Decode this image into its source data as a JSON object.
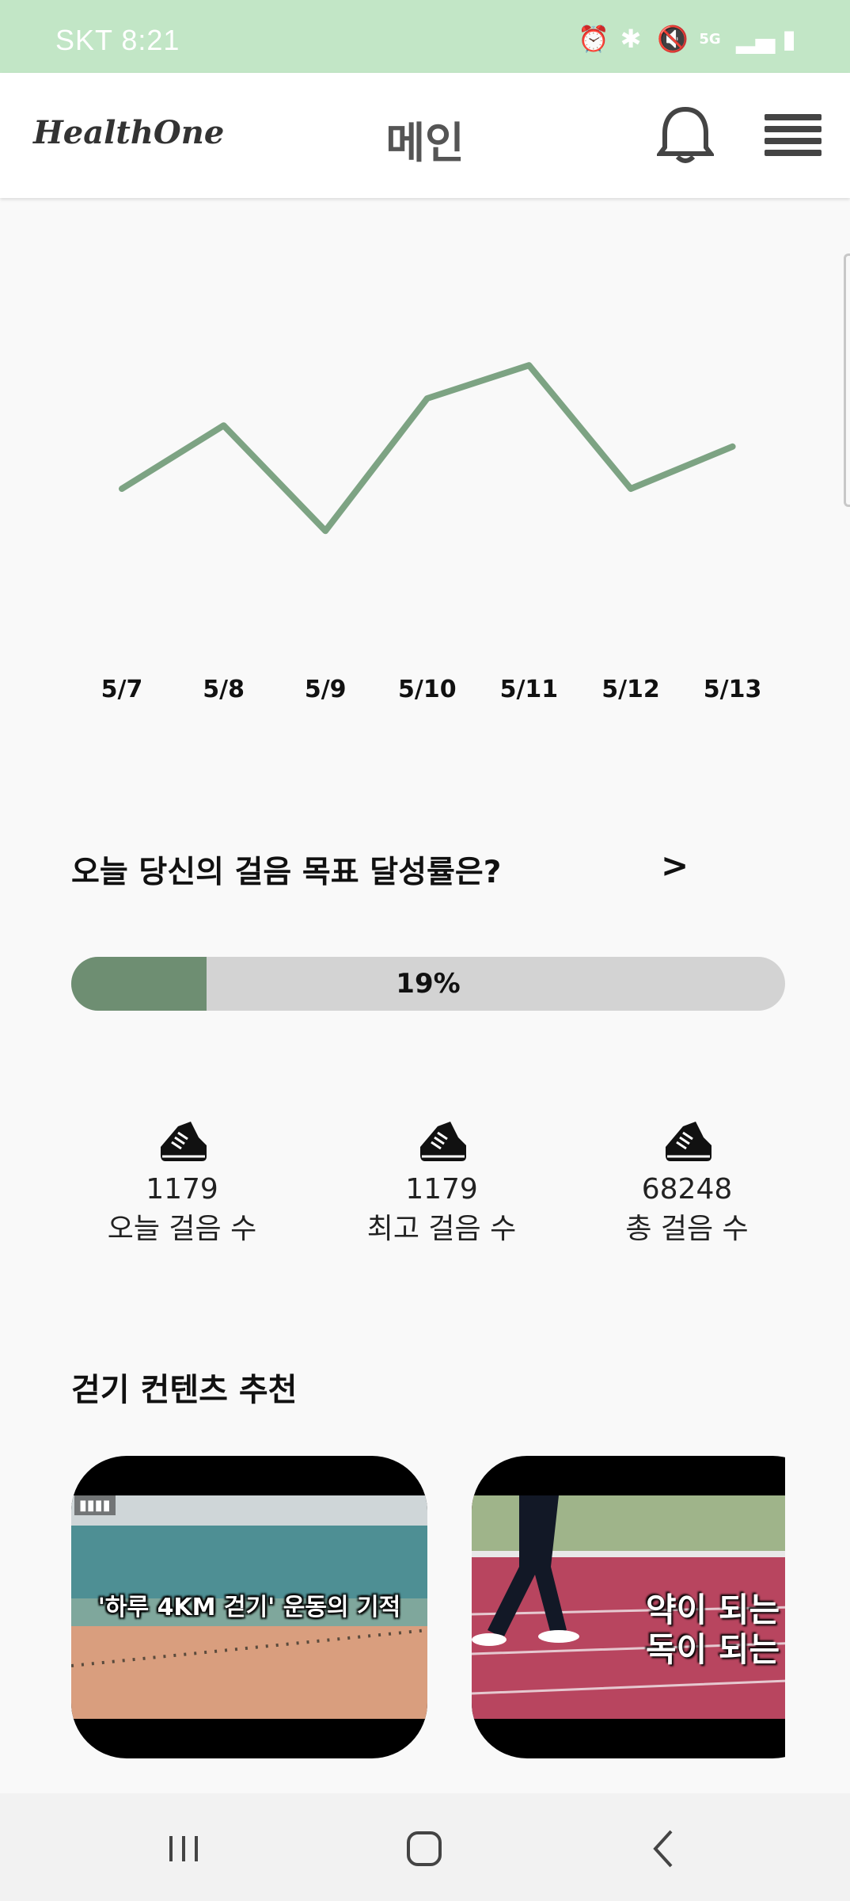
{
  "status_bar": {
    "carrier_time": "SKT 8:21",
    "icons": [
      "alarm-icon",
      "bluetooth-icon",
      "mute-icon",
      "5g-icon",
      "signal-icon",
      "battery-icon"
    ],
    "network": "5G"
  },
  "header": {
    "logo": "HealthOne",
    "title": "메인",
    "bell_icon": "bell-icon",
    "menu_icon": "hamburger-menu-icon"
  },
  "chart_data": {
    "type": "line",
    "x": [
      "5/7",
      "5/8",
      "5/9",
      "5/10",
      "5/11",
      "5/12",
      "5/13"
    ],
    "series": [
      {
        "values": [
          0.35,
          0.56,
          0.21,
          0.65,
          0.76,
          0.35,
          0.49
        ]
      }
    ],
    "title": "",
    "xlabel": "",
    "ylabel": "",
    "grid": false,
    "line_color": "#7da383"
  },
  "goal": {
    "question": "오늘 당신의 걸음 목표 달성률은?",
    "arrow": ">",
    "percent_text": "19%",
    "percent": 0.19,
    "fill_color": "#6e8e72",
    "track_color": "#d3d3d3"
  },
  "stats": [
    {
      "icon": "sneaker-icon",
      "value": "1179",
      "label": "오늘 걸음 수"
    },
    {
      "icon": "sneaker-icon",
      "value": "1179",
      "label": "최고 걸음 수"
    },
    {
      "icon": "sneaker-icon",
      "value": "68248",
      "label": "총 걸음 수"
    }
  ],
  "recommend": {
    "title": "걷기 컨텐츠 추천",
    "videos": [
      {
        "caption": "'하루 4KM 걷기' 운동의 기적"
      },
      {
        "caption_line1": "약이 되는",
        "caption_line2": "독이 되는"
      }
    ]
  },
  "nav": {
    "recents_icon": "recent-apps-icon",
    "home_icon": "home-icon",
    "back_icon": "back-icon"
  }
}
